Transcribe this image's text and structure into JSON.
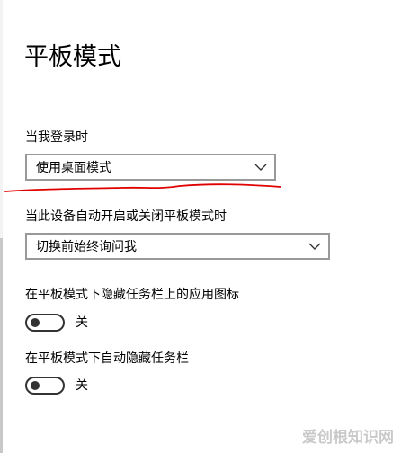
{
  "page": {
    "title": "平板模式"
  },
  "login": {
    "label": "当我登录时",
    "dropdown_value": "使用桌面模式"
  },
  "switch_mode": {
    "label": "当此设备自动开启或关闭平板模式时",
    "dropdown_value": "切换前始终询问我"
  },
  "hide_icons": {
    "label": "在平板模式下隐藏任务栏上的应用图标",
    "toggle_state": "关",
    "toggle_on": false
  },
  "auto_hide_taskbar": {
    "label": "在平板模式下自动隐藏任务栏",
    "toggle_state": "关",
    "toggle_on": false
  },
  "annotation": {
    "color": "#e00000"
  },
  "watermark": {
    "text": "爱创根知识网"
  }
}
